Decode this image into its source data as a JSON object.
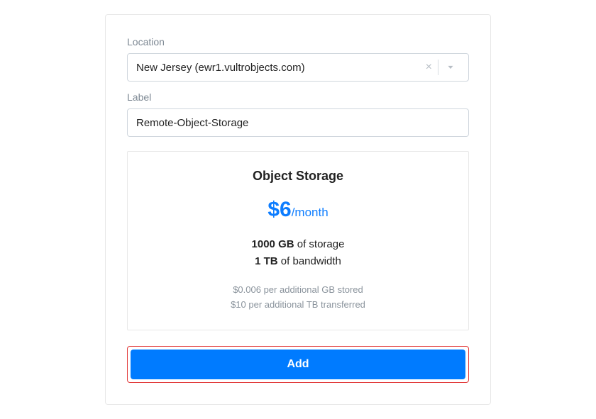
{
  "location": {
    "label": "Location",
    "value": "New Jersey (ewr1.vultrobjects.com)"
  },
  "label_field": {
    "label": "Label",
    "value": "Remote-Object-Storage"
  },
  "plan": {
    "title": "Object Storage",
    "price": "$6",
    "period": "/month",
    "storage_amount": "1000 GB",
    "storage_suffix": " of storage",
    "bandwidth_amount": "1 TB",
    "bandwidth_suffix": " of bandwidth",
    "fine1": "$0.006 per additional GB stored",
    "fine2": "$10 per additional TB transferred"
  },
  "buttons": {
    "add": "Add"
  }
}
